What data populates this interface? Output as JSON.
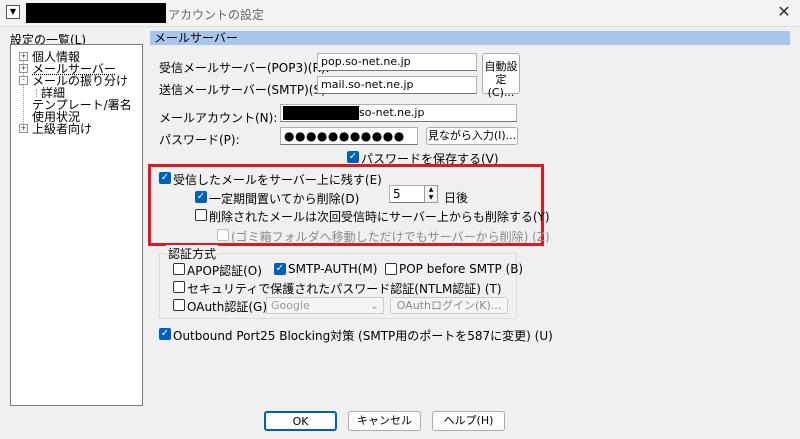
{
  "window": {
    "title": "アカウントの設定",
    "system_menu_icon": "dropdown-arrow-icon",
    "close_icon": "close-icon"
  },
  "tree": {
    "label": "設定の一覧(L)",
    "items": [
      {
        "label": "個人情報",
        "expander": "+"
      },
      {
        "label": "メールサーバー",
        "expander": "+"
      },
      {
        "label": "メールの振り分け",
        "expander": "-"
      },
      {
        "label": "詳細",
        "expander": ""
      },
      {
        "label": "テンプレート/署名",
        "expander": ""
      },
      {
        "label": "使用状況",
        "expander": ""
      },
      {
        "label": "上級者向け",
        "expander": "+"
      }
    ]
  },
  "section_title": "メールサーバー",
  "pop": {
    "label": "受信メールサーバー(POP3)(R):",
    "value": "pop.so-net.ne.jp"
  },
  "smtp": {
    "label": "送信メールサーバー(SMTP)(S):",
    "value": "mail.so-net.ne.jp"
  },
  "auto_button": {
    "line1": "自動設",
    "line2": "定(C)..."
  },
  "account": {
    "label": "メールアカウント(N):",
    "value_suffix": "so-net.ne.jp"
  },
  "password": {
    "label": "パスワード(P):",
    "value": "●●●●●●●●●●●",
    "show_button": "見ながら入力(I)..."
  },
  "save_password": {
    "label": "パスワードを保存する(V)",
    "checked": true
  },
  "leave_on_server": {
    "label": "受信したメールをサーバー上に残す(E)",
    "checked": true
  },
  "delete_after_period": {
    "label": "一定期間置いてから削除(D)",
    "checked": true,
    "days": "5",
    "unit": "日後"
  },
  "delete_when_deleted": {
    "label": "削除されたメールは次回受信時にサーバー上からも削除する(Y)",
    "checked": false
  },
  "trash_only": {
    "label": "(ゴミ箱フォルダへ移動しただけでもサーバーから削除) (Z)",
    "checked": false,
    "disabled": true
  },
  "auth": {
    "title": "認証方式",
    "apop": {
      "label": "APOP認証(O)",
      "checked": false
    },
    "smtp_auth": {
      "label": "SMTP-AUTH(M)",
      "checked": true
    },
    "pop_before_smtp": {
      "label": "POP before SMTP (B)",
      "checked": false
    },
    "ntlm": {
      "label": "セキュリティで保護されたパスワード認証(NTLM認証) (T)",
      "checked": false
    },
    "oauth": {
      "label": "OAuth認証(G)",
      "checked": false,
      "provider": "Google",
      "login_button": "OAuthログイン(K)..."
    }
  },
  "outbound_port25": {
    "label": "Outbound Port25 Blocking対策 (SMTP用のポートを587に変更) (U)",
    "checked": true
  },
  "buttons": {
    "ok": "OK",
    "cancel": "キャンセル",
    "help": "ヘルプ(H)"
  },
  "colors": {
    "accent": "#005fb8",
    "highlight_box": "#d91c23",
    "section_header": "#a9c5eb"
  }
}
